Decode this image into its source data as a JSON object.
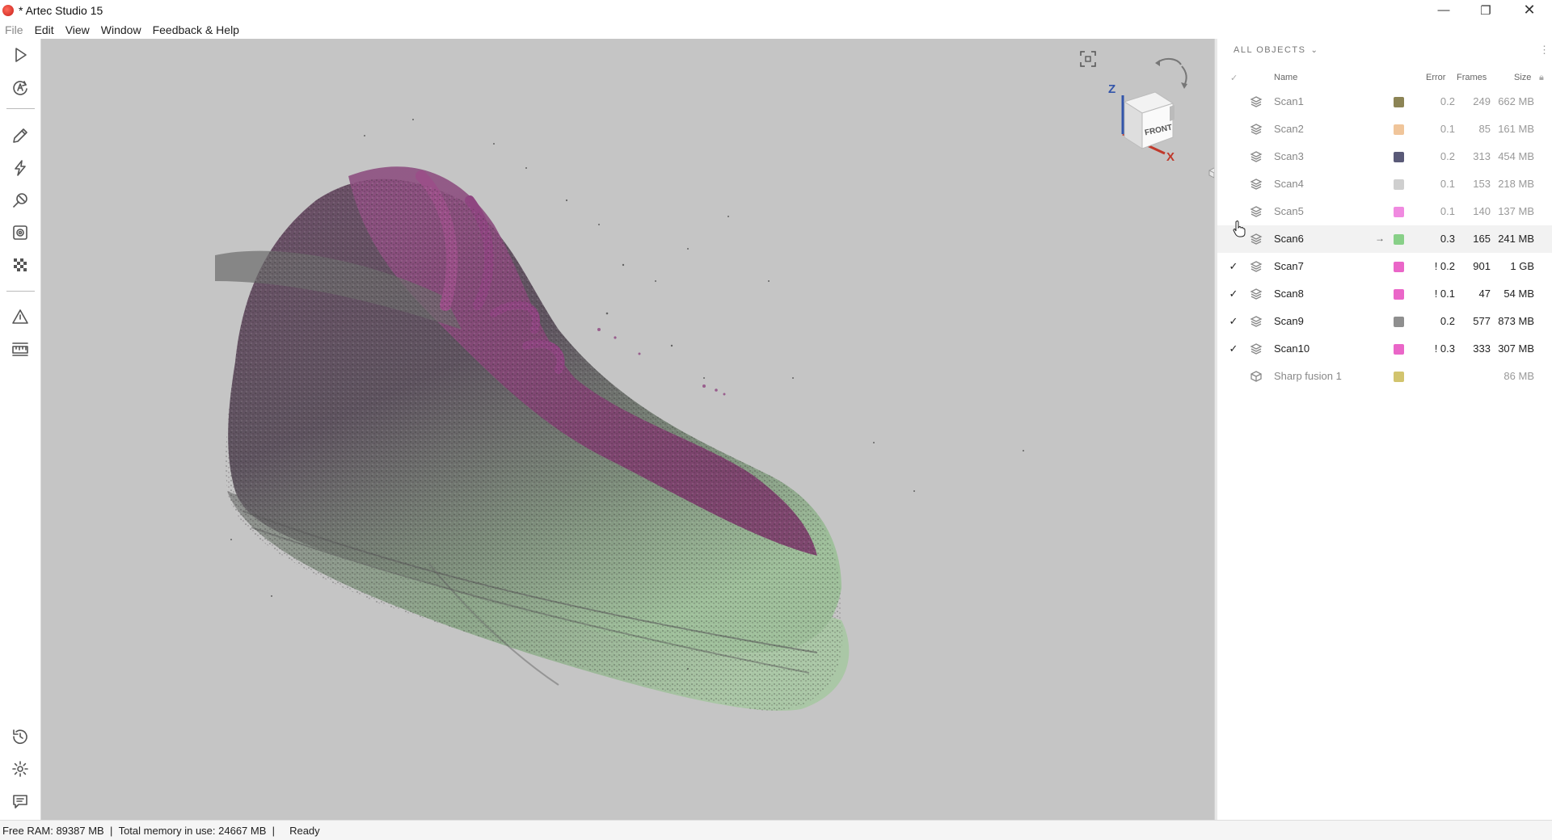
{
  "window": {
    "title": "* Artec Studio 15",
    "minimize_glyph": "—",
    "maximize_glyph": "❐",
    "close_glyph": "✕"
  },
  "menu": [
    "File",
    "Edit",
    "View",
    "Window",
    "Feedback & Help"
  ],
  "left_toolbar": {
    "top_tools": [
      "play-icon",
      "autopilot-icon",
      "pencil-icon",
      "lightning-icon",
      "tools-icon",
      "target-icon",
      "texture-icon",
      "triangle-icon",
      "ruler-icon"
    ],
    "bottom_tools": [
      "history-icon",
      "gear-icon",
      "chat-icon"
    ]
  },
  "viewport": {
    "cube_face": "FRONT",
    "axis_z": "Z",
    "axis_x": "X",
    "background": "#c5c5c5"
  },
  "panel": {
    "filter_label": "ALL OBJECTS",
    "headers": {
      "check": "✓",
      "name": "Name",
      "error": "Error",
      "frames": "Frames",
      "size": "Size"
    },
    "rows": [
      {
        "checked": "",
        "name": "Scan1",
        "color": "#8c8455",
        "error": "0.2",
        "frames": "249",
        "size": "662 MB"
      },
      {
        "checked": "",
        "name": "Scan2",
        "color": "#f0c59a",
        "error": "0.1",
        "frames": "85",
        "size": "161 MB"
      },
      {
        "checked": "",
        "name": "Scan3",
        "color": "#5a5a78",
        "error": "0.2",
        "frames": "313",
        "size": "454 MB"
      },
      {
        "checked": "",
        "name": "Scan4",
        "color": "#cfcfcf",
        "error": "0.1",
        "frames": "153",
        "size": "218 MB"
      },
      {
        "checked": "",
        "name": "Scan5",
        "color": "#f08ae0",
        "error": "0.1",
        "frames": "140",
        "size": "137 MB"
      },
      {
        "checked": "",
        "name": "Scan6",
        "color": "#88d088",
        "error": "0.3",
        "frames": "165",
        "size": "241 MB",
        "arrow": "→"
      },
      {
        "checked": "✓",
        "name": "Scan7",
        "color": "#ea66c8",
        "error": "! 0.2",
        "frames": "901",
        "size": "1 GB"
      },
      {
        "checked": "✓",
        "name": "Scan8",
        "color": "#ea66c8",
        "error": "! 0.1",
        "frames": "47",
        "size": "54 MB"
      },
      {
        "checked": "✓",
        "name": "Scan9",
        "color": "#8f8f8f",
        "error": "0.2",
        "frames": "577",
        "size": "873 MB"
      },
      {
        "checked": "✓",
        "name": "Scan10",
        "color": "#ea66c8",
        "error": "! 0.3",
        "frames": "333",
        "size": "307 MB"
      },
      {
        "checked": "",
        "name": "Sharp fusion 1",
        "color": "#d2c46e",
        "error": "",
        "frames": "",
        "size": "86 MB"
      }
    ]
  },
  "status": {
    "free_ram": "Free RAM: 89387 MB",
    "total_memory": "Total memory in use: 24667 MB",
    "state": "Ready",
    "separator": "|"
  }
}
